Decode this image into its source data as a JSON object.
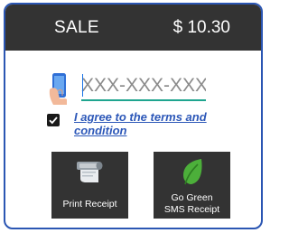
{
  "header": {
    "title": "SALE",
    "amount": "$ 10.30"
  },
  "phone": {
    "placeholder": "XXX-XXX-XXXX",
    "value": ""
  },
  "terms": {
    "checked": true,
    "label": "I agree to the terms and condition"
  },
  "buttons": {
    "print_label": "Print Receipt",
    "green_label_line1": "Go Green",
    "green_label_line2": "SMS Receipt"
  },
  "colors": {
    "header_bg": "#333333",
    "frame_border": "#2b56b3",
    "link": "#2c57b8",
    "input_underline": "#1fa58f",
    "leaf": "#4caf3a"
  },
  "icons": {
    "phone": "phone-hand-icon",
    "checkbox": "checkmark-icon",
    "print": "printer-icon",
    "green": "leaf-icon"
  }
}
